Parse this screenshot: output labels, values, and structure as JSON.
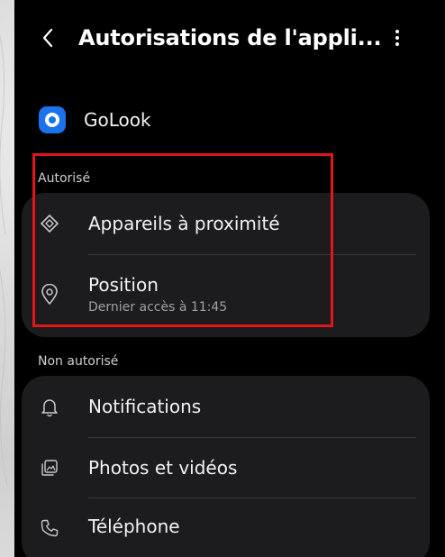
{
  "header": {
    "title": "Autorisations de l'appli...",
    "back_icon": "chevron-left-icon",
    "more_icon": "more-vertical-icon"
  },
  "app": {
    "name": "GoLook",
    "icon": "golook-app-icon",
    "icon_color": "#1a73e8"
  },
  "allowed": {
    "section_label": "Autorisé",
    "items": [
      {
        "label": "Appareils à proximité",
        "icon": "nearby-devices-icon"
      },
      {
        "label": "Position",
        "subtitle": "Dernier accès à 11:45",
        "icon": "location-pin-icon"
      }
    ]
  },
  "not_allowed": {
    "section_label": "Non autorisé",
    "items": [
      {
        "label": "Notifications",
        "icon": "bell-icon"
      },
      {
        "label": "Photos et vidéos",
        "icon": "photos-icon"
      },
      {
        "label": "Téléphone",
        "icon": "phone-icon"
      }
    ]
  },
  "colors": {
    "screen_background": "#000000",
    "card_background": "#1c1c1e",
    "highlight_border": "#e0161b",
    "secondary_text": "#a0a0a0"
  }
}
